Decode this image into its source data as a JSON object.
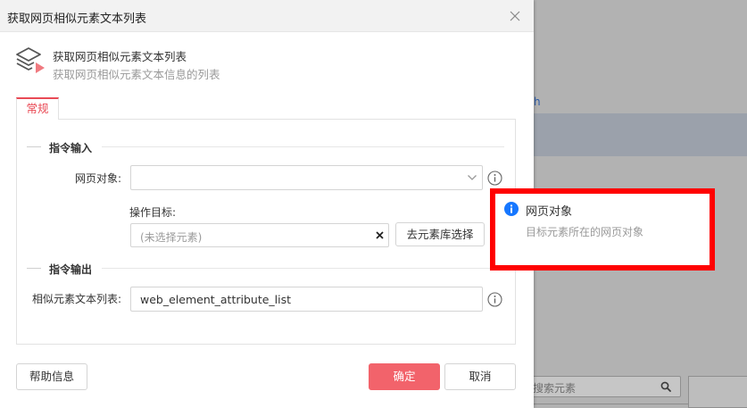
{
  "background": {
    "link_fragment": "h",
    "search_placeholder": "搜索元素",
    "search_icon": "search-icon"
  },
  "dialog": {
    "title": "获取网页相似元素文本列表",
    "close_icon": "close-icon",
    "command": {
      "icon": "layers-play-icon",
      "name": "获取网页相似元素文本列表",
      "description": "获取网页相似元素文本信息的列表"
    },
    "tabs": [
      {
        "label": "常规",
        "active": true
      }
    ],
    "input_section": {
      "title": "指令输入",
      "web_object_label": "网页对象:",
      "web_object_value": "",
      "operation_target_label": "操作目标:",
      "operation_target_placeholder": "(未选择元素)",
      "element_library_button": "去元素库选择"
    },
    "output_section": {
      "title": "指令输出",
      "text_list_label": "相似元素文本列表:",
      "text_list_value": "web_element_attribute_list"
    },
    "footer": {
      "help_button": "帮助信息",
      "confirm_button": "确定",
      "cancel_button": "取消"
    }
  },
  "tooltip": {
    "icon": "info-icon",
    "title": "网页对象",
    "description": "目标元素所在的网页对象"
  },
  "colors": {
    "accent": "#e94a55",
    "confirm_button": "#f2636b",
    "highlight_frame": "#ff0000",
    "info_blue": "#1677ff",
    "overlay": "#a7a7a7"
  }
}
